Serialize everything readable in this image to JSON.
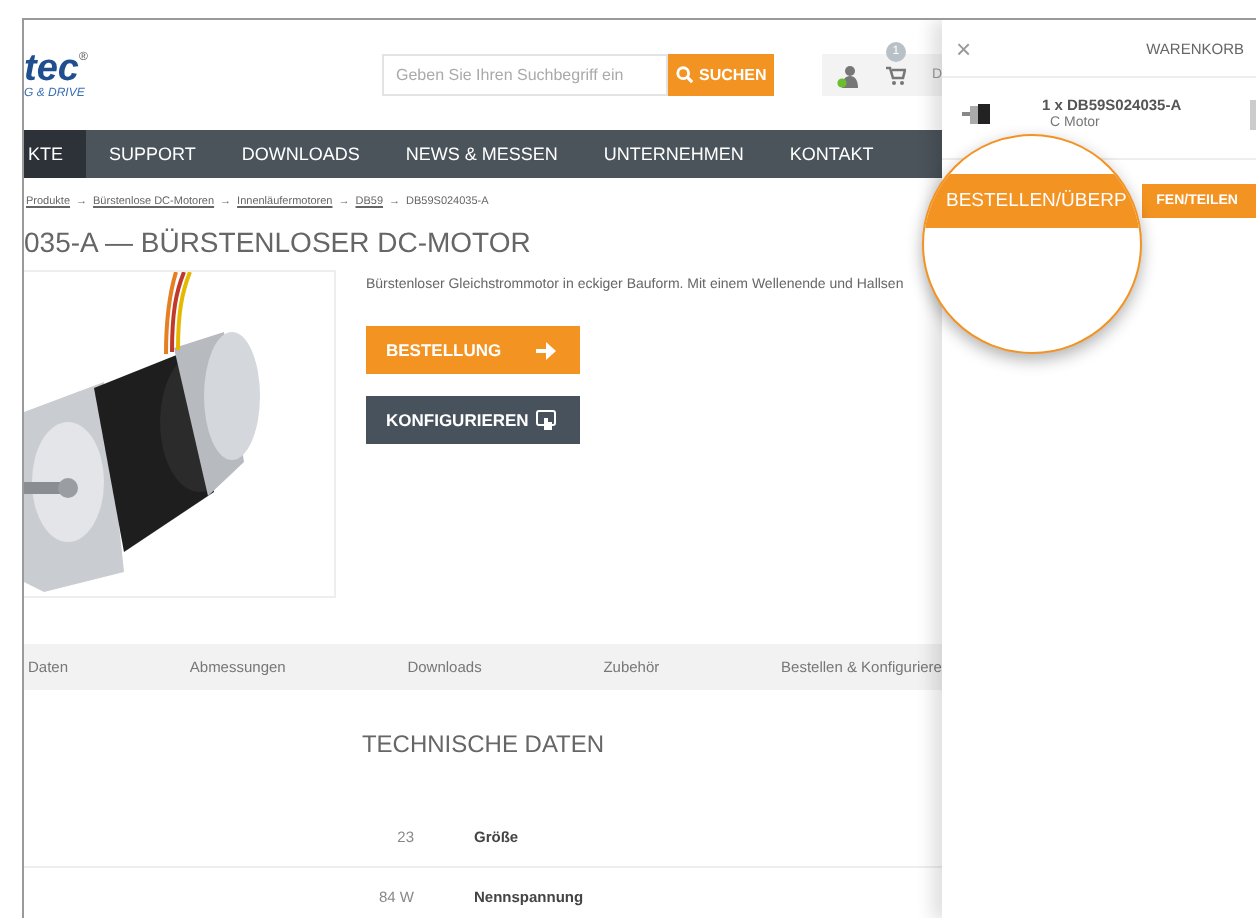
{
  "header": {
    "logo": {
      "text": "tec",
      "mark": "®",
      "tagline": "G & DRIVE"
    },
    "search": {
      "placeholder": "Geben Sie Ihren Suchbegriff ein",
      "button": "SUCHEN"
    },
    "cart_badge": "1",
    "cut_label": "D"
  },
  "nav": [
    {
      "label": "KTE",
      "selected": true
    },
    {
      "label": "SUPPORT",
      "selected": false
    },
    {
      "label": "DOWNLOADS",
      "selected": false
    },
    {
      "label": "NEWS & MESSEN",
      "selected": false
    },
    {
      "label": "UNTERNEHMEN",
      "selected": false
    },
    {
      "label": "KONTAKT",
      "selected": false
    }
  ],
  "breadcrumb": [
    "Produkte",
    "Bürstenlose DC-Motoren",
    "Innenläufermotoren",
    "DB59",
    "DB59S024035-A"
  ],
  "breadcrumb_separator": "→",
  "title": "035-A — BÜRSTENLOSER DC-MOTOR",
  "product": {
    "description": "Bürstenloser Gleichstrommotor in eckiger Bauform. Mit einem Wellenende und Hallsen",
    "buttons": [
      {
        "label": "BESTELLUNG",
        "kind": "order"
      },
      {
        "label": "KONFIGURIEREN",
        "kind": "configure"
      }
    ]
  },
  "tabs": [
    {
      "label": "Daten",
      "selected": false
    },
    {
      "label": "Abmessungen",
      "selected": false
    },
    {
      "label": "Downloads",
      "selected": false
    },
    {
      "label": "Zubehör",
      "selected": false
    },
    {
      "label": "Bestellen & Konfiguriere",
      "selected": false
    }
  ],
  "spec": {
    "title": "TECHNISCHE DATEN",
    "rows": [
      {
        "value": "23",
        "label": "Größe"
      },
      {
        "value": "84 W",
        "label": "Nennspannung"
      }
    ]
  },
  "cart": {
    "close": "×",
    "title": "WARENKORB",
    "items": [
      {
        "name": "1 x DB59S024035-A",
        "subtitle": "C Motor"
      }
    ],
    "checkout_visible": "FEN/TEILEN"
  },
  "magnifier": {
    "label": "BESTELLEN/ÜBERP"
  }
}
